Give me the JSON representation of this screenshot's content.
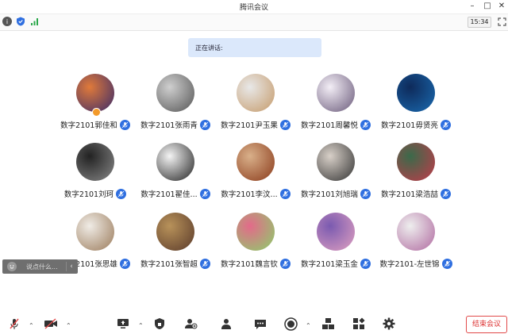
{
  "window": {
    "title": "腾讯会议"
  },
  "topbar": {
    "timer": "15:34"
  },
  "speaking": {
    "label": "正在讲话:"
  },
  "participants": [
    {
      "name": "数字2101郭佳和",
      "colors": [
        "#e07a3a",
        "#3a2a6a"
      ],
      "host": true
    },
    {
      "name": "数字2101张雨青",
      "colors": [
        "#cfcfcf",
        "#555"
      ]
    },
    {
      "name": "数字2101尹玉果",
      "colors": [
        "#e8e8e8",
        "#c59a6a"
      ]
    },
    {
      "name": "数字2101周馨悦",
      "colors": [
        "#f3eef6",
        "#6a5a7a"
      ]
    },
    {
      "name": "数字2101毋贤亮",
      "colors": [
        "#0e2a5a",
        "#1a6ab0"
      ]
    },
    {
      "name": "数字2101刘珂",
      "colors": [
        "#222",
        "#888"
      ]
    },
    {
      "name": "数字2101翟佳...",
      "colors": [
        "#f4f4f4",
        "#222"
      ]
    },
    {
      "name": "数字2101李汶...",
      "colors": [
        "#d9b08a",
        "#8a3a1a"
      ]
    },
    {
      "name": "数字2101刘旭瑞",
      "colors": [
        "#d8d0c8",
        "#333"
      ]
    },
    {
      "name": "数字2101梁浩喆",
      "colors": [
        "#3a6a4a",
        "#c23a4a"
      ]
    },
    {
      "name": "数字2101张思雄",
      "colors": [
        "#f0ece6",
        "#9a7a5a"
      ]
    },
    {
      "name": "数字2101张智超",
      "colors": [
        "#b8925a",
        "#5a3a2a"
      ]
    },
    {
      "name": "数字2101魏言钦",
      "colors": [
        "#e36a8a",
        "#8ad06a"
      ]
    },
    {
      "name": "数字2101梁玉金",
      "colors": [
        "#7a5ab0",
        "#e0a0c0"
      ]
    },
    {
      "name": "数字2101-左世锦",
      "colors": [
        "#eeeeee",
        "#b06aa0"
      ]
    }
  ],
  "chat": {
    "placeholder": "说点什么..."
  },
  "toolbar": {
    "end_label": "结束会议"
  },
  "accent": {
    "blue": "#2f6fe0",
    "red": "#e24b4b"
  }
}
